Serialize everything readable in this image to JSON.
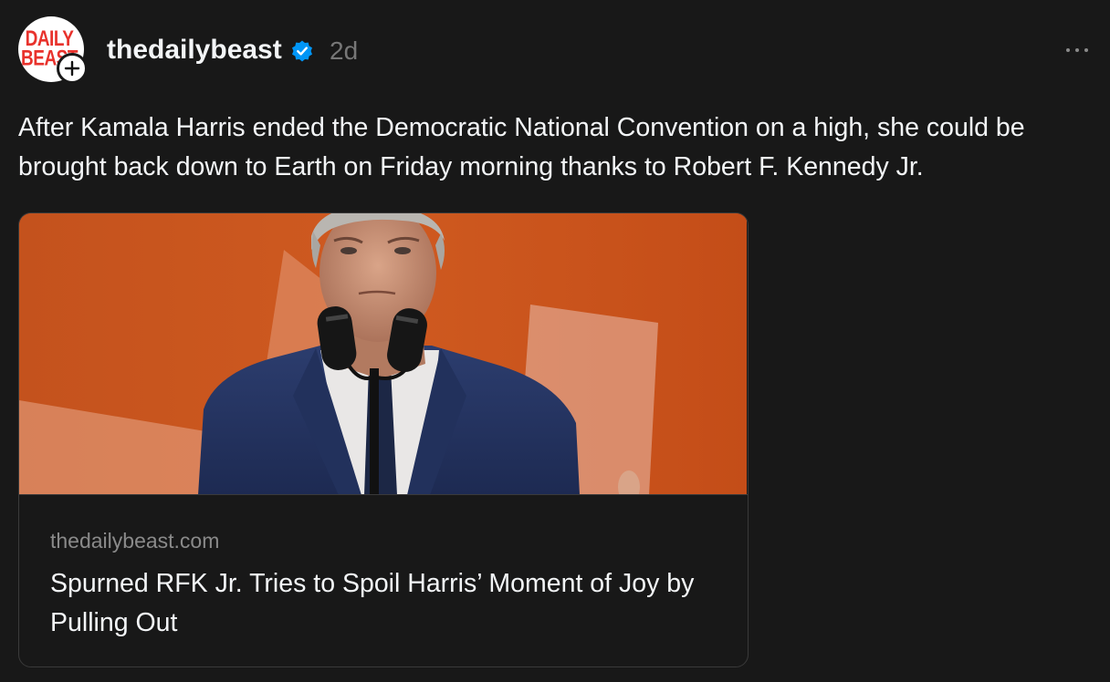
{
  "post": {
    "author": {
      "username": "thedailybeast",
      "verified": true,
      "avatar_logo_lines": [
        "DAILY",
        "BEAST"
      ]
    },
    "timestamp": "2d",
    "caption": "After Kamala Harris ended the Democratic National Convention on a high, she could be brought back down to Earth on Friday morning thanks to Robert F. Kennedy Jr.",
    "link_card": {
      "domain": "thedailybeast.com",
      "title": "Spurned RFK Jr. Tries to Spoil Harris’ Moment of Joy by Pulling Out"
    }
  },
  "icons": {
    "follow": "plus-icon",
    "verified": "verified-badge-icon",
    "more": "more-options-icon"
  },
  "colors": {
    "background": "#181818",
    "text_primary": "#f3f5f7",
    "text_secondary": "#777777",
    "verified_blue": "#0095f6",
    "logo_red": "#e8322c",
    "image_orange": "#c9531c"
  }
}
